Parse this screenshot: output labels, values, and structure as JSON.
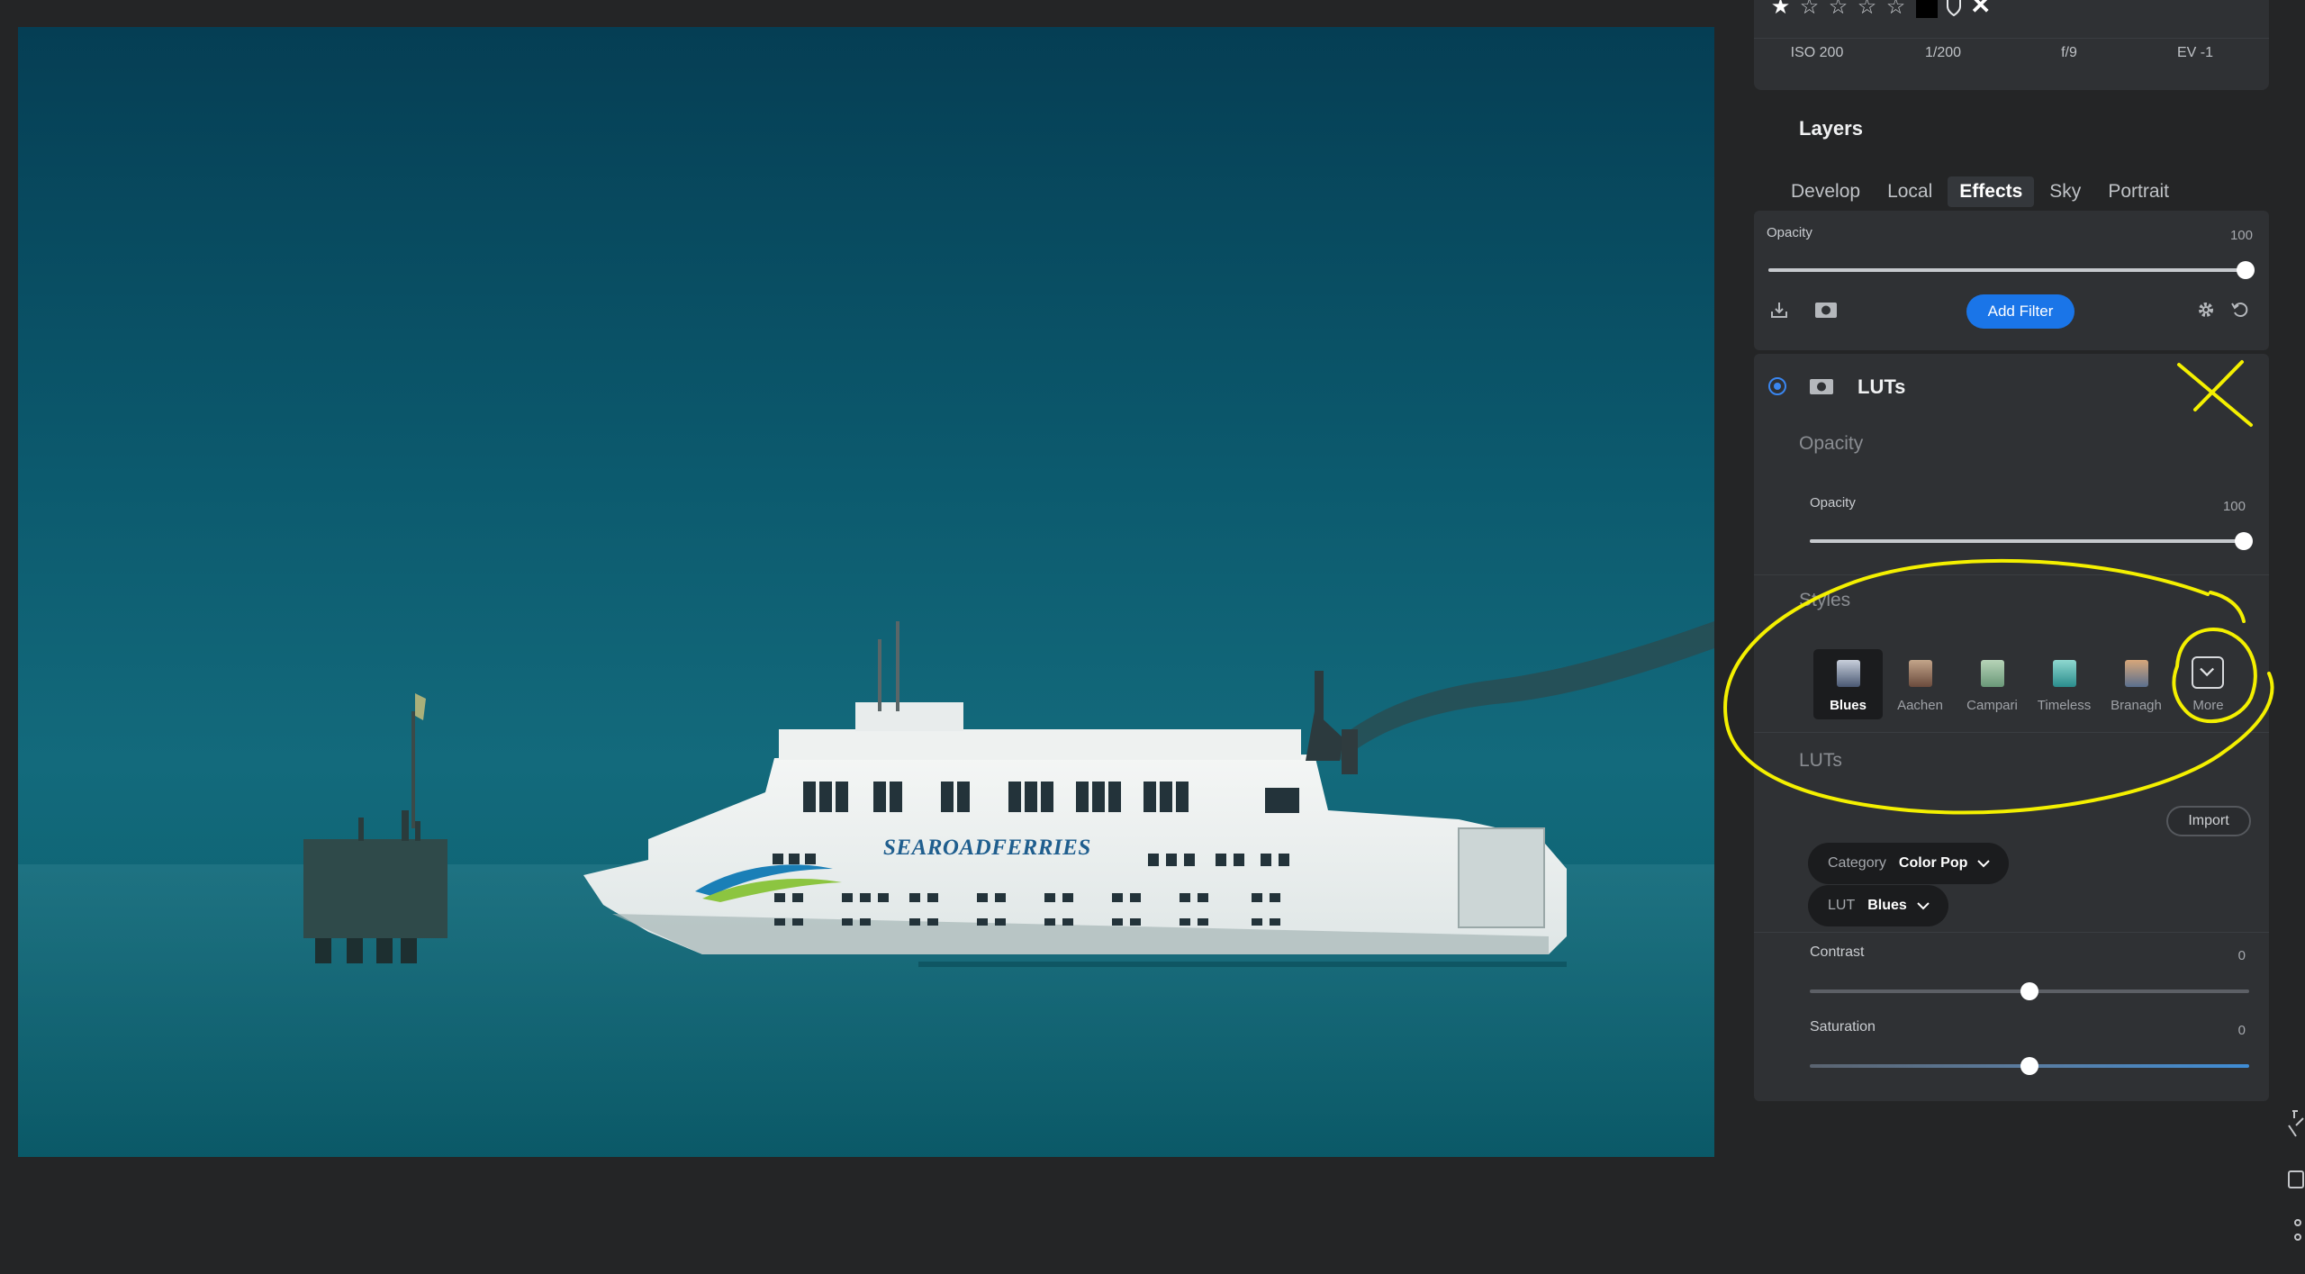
{
  "photo": {
    "ferry_name": "SEAROADFERRIES",
    "alt": "Ferry on the sea"
  },
  "rating": {
    "stars_filled": 1,
    "stars_total": 5,
    "star_filled_glyph": "★",
    "star_empty_glyph": "☆",
    "reject_glyph": "✕"
  },
  "exif": {
    "iso": "ISO 200",
    "shutter": "1/200",
    "aperture": "f/9",
    "ev": "EV -1"
  },
  "layers": {
    "title": "Layers",
    "tabs": [
      {
        "label": "Develop"
      },
      {
        "label": "Local"
      },
      {
        "label": "Effects",
        "active": true
      },
      {
        "label": "Sky"
      },
      {
        "label": "Portrait"
      }
    ],
    "opacity_label": "Opacity",
    "opacity_value": "100",
    "opacity_fraction": 1.0,
    "add_filter_label": "Add Filter"
  },
  "luts_filter": {
    "title": "LUTs",
    "opacity_section": "Opacity",
    "opacity_label": "Opacity",
    "opacity_value": "100",
    "opacity_fraction": 1.0,
    "styles_section": "Styles",
    "styles": [
      {
        "name": "Blues",
        "selected": true,
        "swatch": [
          "#c8cfdb",
          "#4a5873"
        ]
      },
      {
        "name": "Aachen",
        "selected": false,
        "swatch": [
          "#c3a58a",
          "#6a4a3c"
        ]
      },
      {
        "name": "Campari",
        "selected": false,
        "swatch": [
          "#b7d4b8",
          "#6a9878"
        ]
      },
      {
        "name": "Timeless",
        "selected": false,
        "swatch": [
          "#8fd8d0",
          "#2a8c8c"
        ]
      },
      {
        "name": "Branagh",
        "selected": false,
        "swatch": [
          "#d7a77a",
          "#5a6f8e"
        ]
      },
      {
        "name": "More",
        "selected": false
      }
    ],
    "luts_section": "LUTs",
    "import_label": "Import",
    "category_key": "Category",
    "category_value": "Color Pop",
    "lut_key": "LUT",
    "lut_value": "Blues",
    "contrast_label": "Contrast",
    "contrast_value": "0",
    "contrast_fraction": 0.5,
    "saturation_label": "Saturation",
    "saturation_value": "0",
    "saturation_fraction": 0.5
  },
  "colors": {
    "accent": "#1a75e8",
    "annotation": "#f4f000",
    "panel": "#2f3134",
    "background": "#242526"
  },
  "icons": {
    "export": "export-icon",
    "mask": "mask-icon",
    "settings": "gear-icon",
    "reset": "reset-icon",
    "chevron": "chevron-down-icon"
  }
}
